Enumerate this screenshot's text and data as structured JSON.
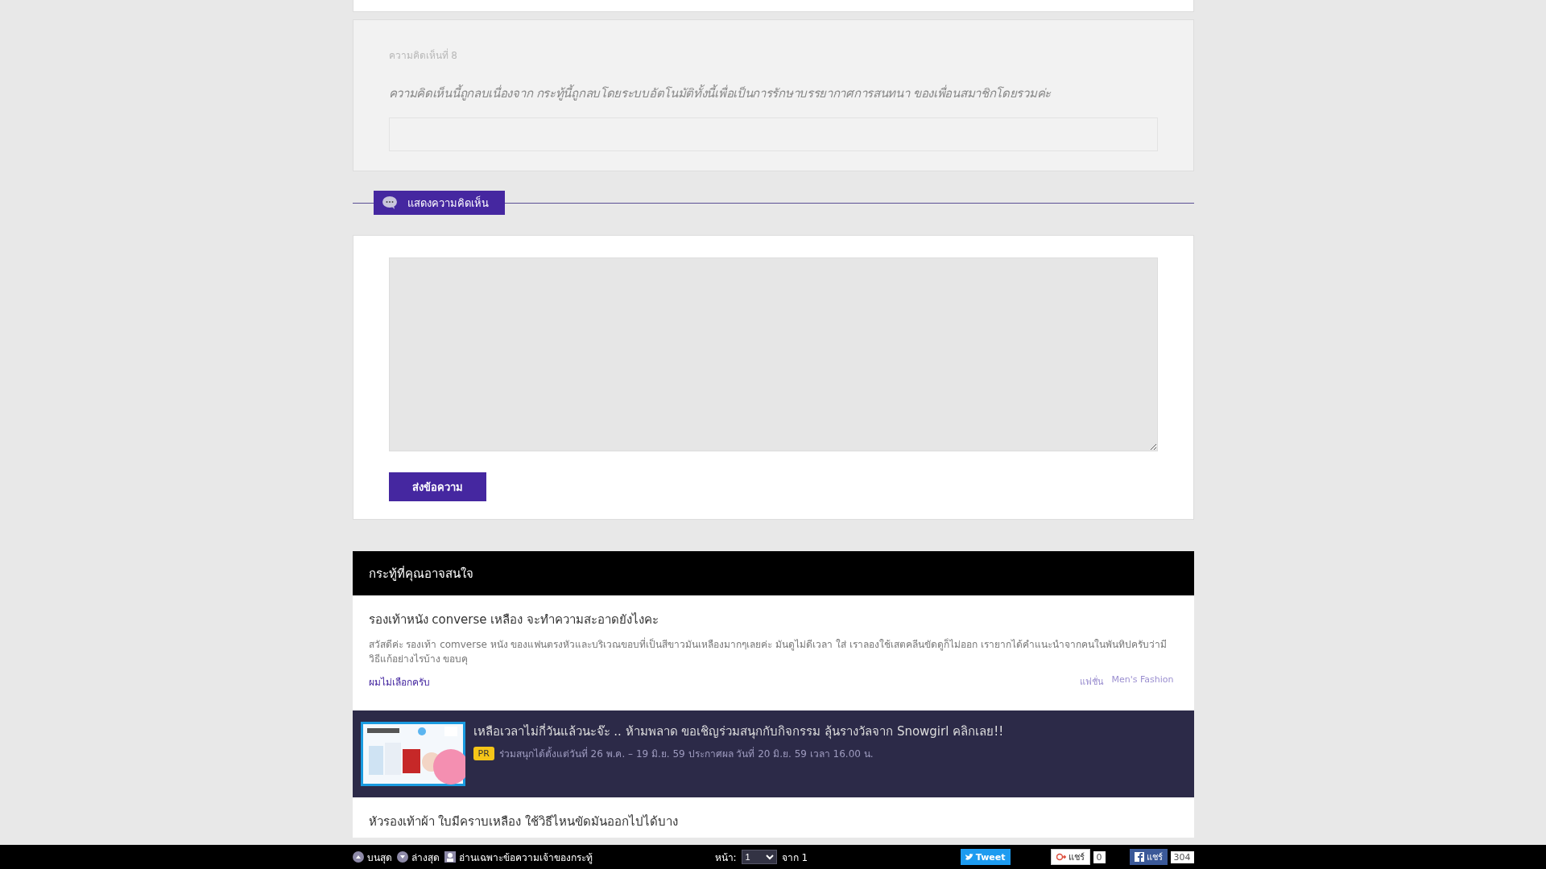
{
  "deleted_comment": {
    "label": "ความคิดเห็นที่ 8",
    "message": "ความคิดเห็นนี้ถูกลบเนื่องจาก กระทู้นี้ถูกลบโดยระบบอัตโนมัติทั้งนี้เพื่อเป็นการรักษาบรรยากาศการสนทนา ของเพื่อนสมาชิกโดยรวมค่ะ"
  },
  "comment_header": {
    "label": "แสดงความคิดเห็น"
  },
  "comment_form": {
    "submit": "ส่งข้อความ"
  },
  "related": {
    "title": "กระทู้ที่คุณอาจสนใจ",
    "items": [
      {
        "kind": "topic",
        "title": "รองเท้าหนัง converse เหลือง จะทำความสะอาดยังไงคะ",
        "excerpt": "สวัสดีค่ะ รองเท้า comverse หนัง ของแฟนตรงหัวและบริเวณขอบที่เป็นสีขาวมันเหลืองมากๆเลยค่ะ มันดูไม่ดีเวลา ใส่ เราลองใช้เสตคลีนขัดดูก็ไม่ออก เรายากได้คำแนะนำจากคนในพันทิปครับว่ามีวิธีแก้อย่างไรบ้าง ขอบคุ",
        "author": "ผมไม่เลือกครับ",
        "tags": [
          "แฟชั่น",
          "Men's Fashion"
        ]
      },
      {
        "kind": "promo",
        "title": "เหลือเวลาไม่กี่วันแล้วนะจ๊ะ .. ห้ามพลาด ขอเชิญร่วมสนุกกับกิจกรรม ลุ้นรางวัลจาก Snowgirl คลิกเลย!!",
        "badge": "PR",
        "detail": "ร่วมสนุกได้ตั้งแต่วันที่ 26 พ.ค. – 19 มิ.ย. 59 ประกาศผล วันที่ 20 มิ.ย. 59 เวลา 16.00 น."
      },
      {
        "kind": "topic",
        "title": "หัวรองเท้าผ้า ใบมีคราบเหลือง ใช้วิธีไหนขัดมันออกไปได้บาง"
      }
    ]
  },
  "bottom_bar": {
    "top": "บนสุด",
    "bottom": "ล่างสุด",
    "owner_only": "อ่านเฉพาะข้อความเจ้าของกระทู้",
    "page_label": "หน้า:",
    "page": "1",
    "page_of": "จาก 1",
    "tweet": "Tweet",
    "gplus": "แชร์",
    "gplus_count": "0",
    "fb": "แชร์",
    "fb_count": "304"
  }
}
